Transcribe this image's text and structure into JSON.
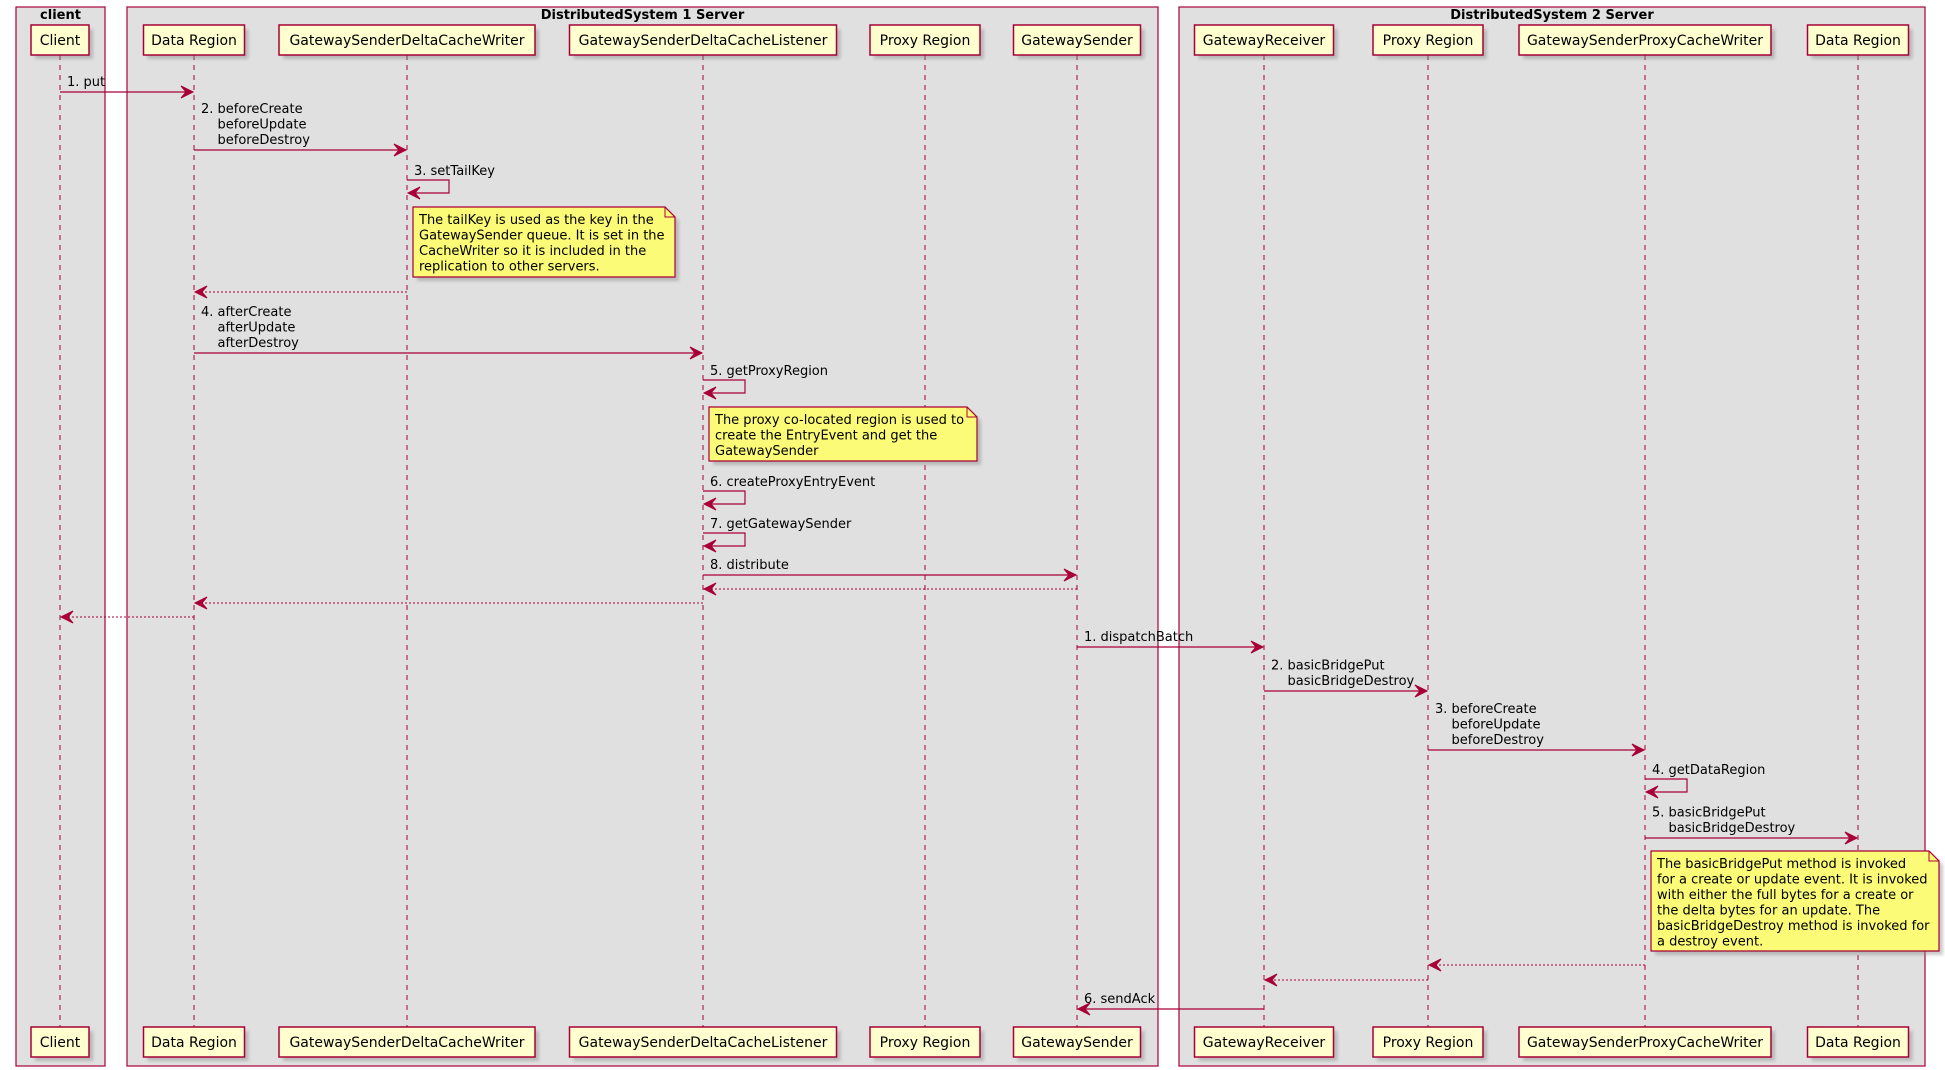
{
  "boxes": [
    {
      "id": "client",
      "title": "client"
    },
    {
      "id": "ds1",
      "title": "DistributedSystem 1 Server"
    },
    {
      "id": "ds2",
      "title": "DistributedSystem 2 Server"
    }
  ],
  "participants": [
    {
      "id": "client",
      "label": "Client",
      "box": "client"
    },
    {
      "id": "dr1",
      "label": "Data Region",
      "box": "ds1"
    },
    {
      "id": "gsdcw",
      "label": "GatewaySenderDeltaCacheWriter",
      "box": "ds1"
    },
    {
      "id": "gsdcl",
      "label": "GatewaySenderDeltaCacheListener",
      "box": "ds1"
    },
    {
      "id": "pr1",
      "label": "Proxy Region",
      "box": "ds1"
    },
    {
      "id": "gs",
      "label": "GatewaySender",
      "box": "ds1"
    },
    {
      "id": "gr",
      "label": "GatewayReceiver",
      "box": "ds2"
    },
    {
      "id": "pr2",
      "label": "Proxy Region",
      "box": "ds2"
    },
    {
      "id": "gspcw",
      "label": "GatewaySenderProxyCacheWriter",
      "box": "ds2"
    },
    {
      "id": "dr2",
      "label": "Data Region",
      "box": "ds2"
    }
  ],
  "messages": [
    {
      "from": "client",
      "to": "dr1",
      "type": "sync",
      "lines": [
        "1. put"
      ]
    },
    {
      "from": "dr1",
      "to": "gsdcw",
      "type": "sync",
      "lines": [
        "2. beforeCreate",
        "    beforeUpdate",
        "    beforeDestroy"
      ]
    },
    {
      "from": "gsdcw",
      "to": "gsdcw",
      "type": "self",
      "lines": [
        "3. setTailKey"
      ]
    },
    {
      "type": "note",
      "over": "gsdcw",
      "lines": [
        "The tailKey is used as the key in the",
        "GatewaySender queue. It is set in the",
        "CacheWriter so it is included in the",
        "replication to other servers."
      ]
    },
    {
      "from": "gsdcw",
      "to": "dr1",
      "type": "return",
      "lines": []
    },
    {
      "from": "dr1",
      "to": "gsdcl",
      "type": "sync",
      "lines": [
        "4. afterCreate",
        "    afterUpdate",
        "    afterDestroy"
      ]
    },
    {
      "from": "gsdcl",
      "to": "gsdcl",
      "type": "self",
      "lines": [
        "5. getProxyRegion"
      ]
    },
    {
      "type": "note",
      "over": "gsdcl",
      "lines": [
        "The proxy co-located region is used to",
        "create the EntryEvent and get the",
        "GatewaySender"
      ]
    },
    {
      "from": "gsdcl",
      "to": "gsdcl",
      "type": "self",
      "lines": [
        "6. createProxyEntryEvent"
      ]
    },
    {
      "from": "gsdcl",
      "to": "gsdcl",
      "type": "self",
      "lines": [
        "7. getGatewaySender"
      ]
    },
    {
      "from": "gsdcl",
      "to": "gs",
      "type": "sync",
      "lines": [
        "8. distribute"
      ]
    },
    {
      "from": "gs",
      "to": "gsdcl",
      "type": "return",
      "lines": []
    },
    {
      "from": "gsdcl",
      "to": "dr1",
      "type": "return",
      "lines": []
    },
    {
      "from": "dr1",
      "to": "client",
      "type": "return",
      "lines": []
    },
    {
      "from": "gs",
      "to": "gr",
      "type": "sync",
      "lines": [
        "1. dispatchBatch"
      ]
    },
    {
      "from": "gr",
      "to": "pr2",
      "type": "sync",
      "lines": [
        "2. basicBridgePut",
        "    basicBridgeDestroy"
      ]
    },
    {
      "from": "pr2",
      "to": "gspcw",
      "type": "sync",
      "lines": [
        "3. beforeCreate",
        "    beforeUpdate",
        "    beforeDestroy"
      ]
    },
    {
      "from": "gspcw",
      "to": "gspcw",
      "type": "self",
      "lines": [
        "4. getDataRegion"
      ]
    },
    {
      "from": "gspcw",
      "to": "dr2",
      "type": "sync",
      "lines": [
        "5. basicBridgePut",
        "    basicBridgeDestroy"
      ]
    },
    {
      "type": "note",
      "over": "gspcw",
      "lines": [
        "The basicBridgePut method is invoked",
        "for a create or update event. It is invoked",
        "with either the full bytes for a create or",
        "the delta bytes for an update. The",
        "basicBridgeDestroy method is invoked for",
        "a destroy event."
      ]
    },
    {
      "from": "gspcw",
      "to": "pr2",
      "type": "return",
      "lines": []
    },
    {
      "from": "pr2",
      "to": "gr",
      "type": "return",
      "lines": []
    },
    {
      "from": "gr",
      "to": "gs",
      "type": "sync",
      "lines": [
        "6. sendAck"
      ]
    }
  ],
  "colors": {
    "line": "#a80036",
    "participant_fill": "#fefece",
    "note_fill": "#fbfb77",
    "box_fill": "#e0e0e0"
  }
}
